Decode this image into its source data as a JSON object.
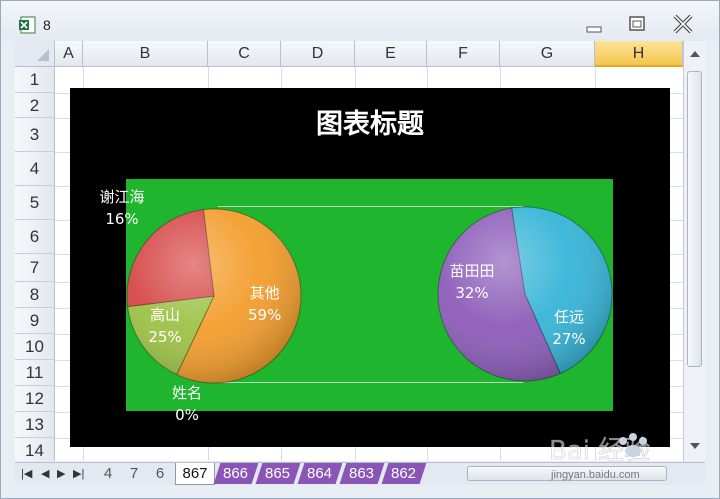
{
  "window": {
    "title": "8"
  },
  "columns": [
    "A",
    "B",
    "C",
    "D",
    "E",
    "F",
    "G",
    "H"
  ],
  "selected_column": "H",
  "rows": [
    "1",
    "2",
    "3",
    "4",
    "5",
    "6",
    "7",
    "8",
    "9",
    "10",
    "11",
    "12",
    "13",
    "14"
  ],
  "chart": {
    "title": "图表标题",
    "chart_area_color": "#000000",
    "plot_area_color": "#1fb52f"
  },
  "chart_data": [
    {
      "type": "pie",
      "categories": [
        "其他",
        "谢江海",
        "高山",
        "姓名"
      ],
      "values": [
        59,
        16,
        25,
        0
      ],
      "data_labels": [
        "其他 59%",
        "谢江海 16%",
        "高山 25%",
        "姓名 0%"
      ],
      "colors": [
        "#f39c2a",
        "#9cc144",
        "#d64545",
        "#888888"
      ]
    },
    {
      "type": "pie",
      "categories": [
        "苗田田",
        "任远"
      ],
      "values": [
        32,
        27
      ],
      "percent_labels": [
        "32%",
        "27%"
      ],
      "colors": [
        "#8b5ab8",
        "#34b4d7"
      ]
    }
  ],
  "labels": {
    "xiejianghai": {
      "name": "谢江海",
      "pct": "16%"
    },
    "gaoshan": {
      "name": "高山",
      "pct": "25%"
    },
    "qita": {
      "name": "其他",
      "pct": "59%"
    },
    "xingming": {
      "name": "姓名",
      "pct": "0%"
    },
    "miaotiantian": {
      "name": "苗田田",
      "pct": "32%"
    },
    "renyuan": {
      "name": "任远",
      "pct": "27%"
    }
  },
  "sheet_tabs": {
    "plain": [
      "4",
      "7",
      "6"
    ],
    "active": "867",
    "purple": [
      "866",
      "865",
      "864",
      "863",
      "862"
    ]
  },
  "watermark": {
    "text": "Bai 经验",
    "url": "jingyan.baidu.com"
  }
}
